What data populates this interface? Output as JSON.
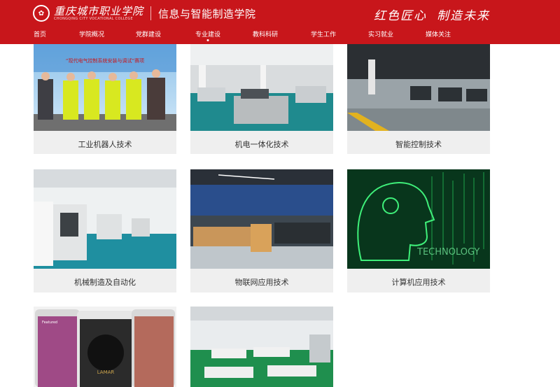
{
  "header": {
    "school_name": "重庆城市职业学院",
    "school_name_en": "CHONGQING CITY VOCATIONAL COLLEGE",
    "college_name": "信息与智能制造学院",
    "slogan_left": "红色匠心",
    "slogan_right": "制造未来",
    "brand_color": "#c8161b"
  },
  "nav": {
    "items": [
      "首页",
      "学院概况",
      "党群建设",
      "专业建设",
      "教科科研",
      "学生工作",
      "实习就业",
      "媒体关注"
    ],
    "active_index": 3,
    "search_icon": "search-icon"
  },
  "majors": [
    {
      "label": "工业机器人技术",
      "photo": "competition-team-photo"
    },
    {
      "label": "机电一体化技术",
      "photo": "mechatronics-lab-photo"
    },
    {
      "label": "智能控制技术",
      "photo": "control-lab-photo"
    },
    {
      "label": "机械制造及自动化",
      "photo": "cnc-workshop-photo"
    },
    {
      "label": "物联网应用技术",
      "photo": "iot-lab-photo"
    },
    {
      "label": "计算机应用技术",
      "photo": "technology-head-illustration"
    },
    {
      "label": "",
      "photo": "mobile-app-screens-photo"
    },
    {
      "label": "",
      "photo": "computer-lab-photo"
    }
  ],
  "photo_texts": {
    "banner": "“现代电气控制系统安装与调试”赛项",
    "technology": "TECHNOLOGY",
    "phone_featured": "Featured",
    "phone_brand": "LAMAR"
  }
}
